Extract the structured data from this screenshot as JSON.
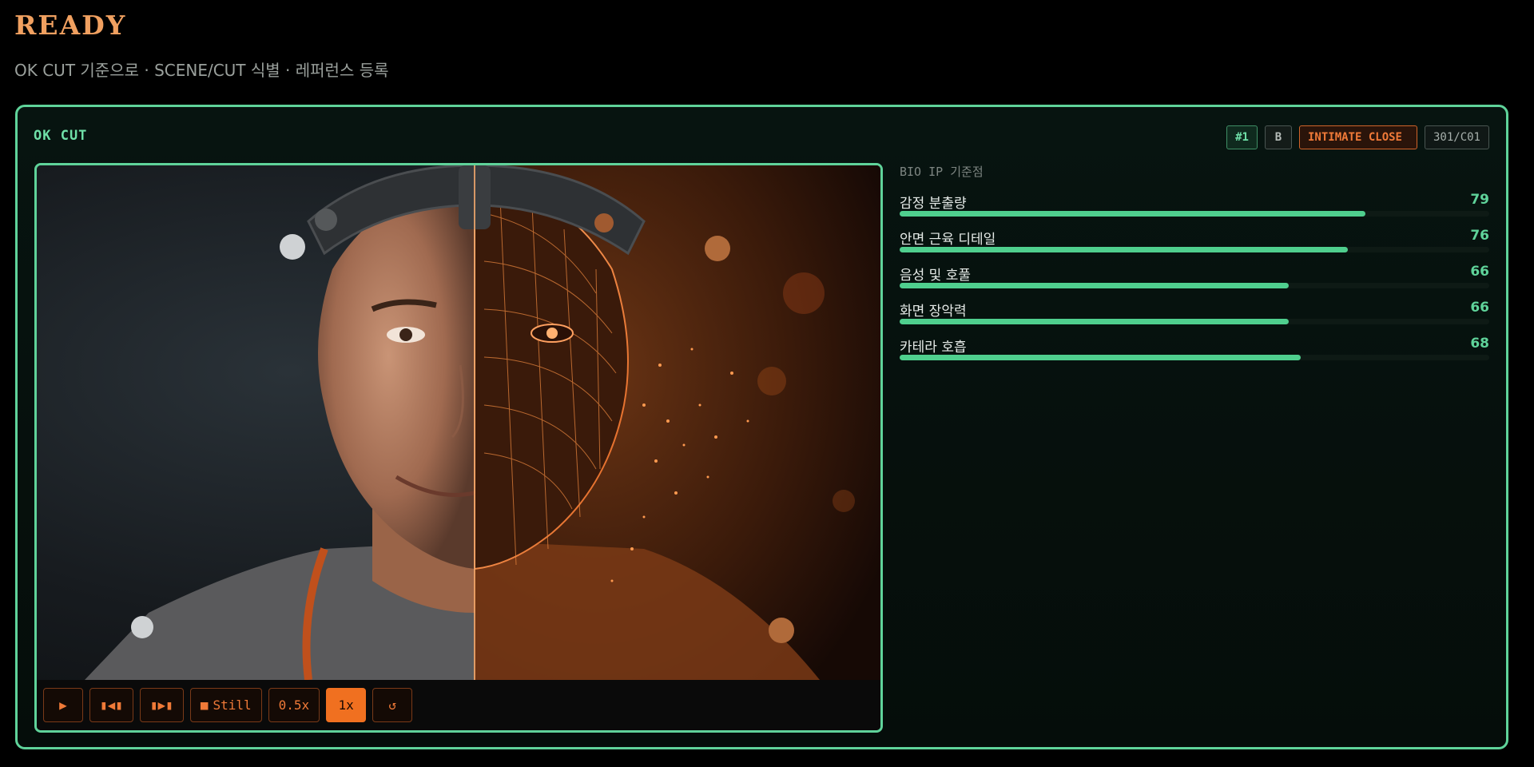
{
  "header": {
    "title": "READY",
    "subtitle": "OK CUT 기준으로 · SCENE/CUT 식별 · 레퍼런스 등록"
  },
  "panel": {
    "label": "OK CUT",
    "tags": {
      "number": "#1",
      "take": "B",
      "shot_type": "INTIMATE CLOSE",
      "scene_cut": "301/C01"
    }
  },
  "metrics": {
    "label": "BIO IP 기준점",
    "items": [
      {
        "name": "감정 분출량",
        "value": 79
      },
      {
        "name": "안면 근육 디테일",
        "value": 76
      },
      {
        "name": "음성 및 호풀",
        "value": 66
      },
      {
        "name": "화면 장악력",
        "value": 66
      },
      {
        "name": "카테라 호흡",
        "value": 68
      }
    ]
  },
  "controls": {
    "play_icon": "play-icon",
    "step_back_icon": "frame-step-back-icon",
    "step_forward_icon": "frame-step-forward-icon",
    "still_label": "Still",
    "speed_half": "0.5x",
    "speed_normal": "1x",
    "selected_speed": "1x",
    "reset_icon": "reset-icon"
  },
  "colors": {
    "accent_green": "#5fd39a",
    "accent_orange": "#f07a38",
    "title_orange": "#f0a060",
    "background": "#000000"
  }
}
